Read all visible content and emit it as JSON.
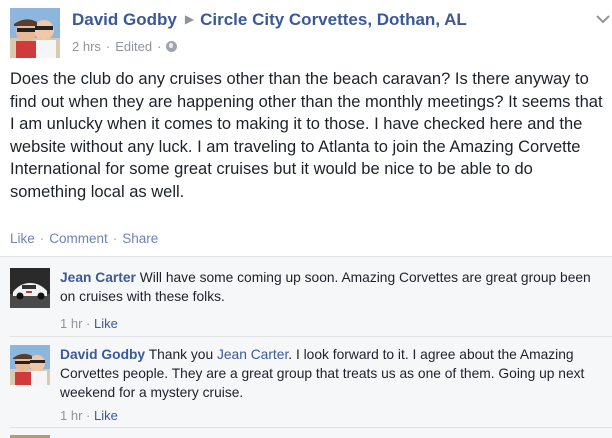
{
  "post": {
    "author": "David Godby",
    "group": "Circle City Corvettes, Dothan, AL",
    "time": "2 hrs",
    "edited": "Edited",
    "text": "Does the club do any cruises other than the beach caravan? Is there anyway to find out when they are happening other than the monthly meetings? It seems that I am unlucky when it comes to making it to those. I have checked here and the website without any luck. I am traveling to Atlanta to join the Amazing Corvette International for some great cruises but it would be nice to be able to do something local as well."
  },
  "actions": {
    "like": "Like",
    "comment": "Comment",
    "share": "Share"
  },
  "comments": [
    {
      "name": "Jean Carter",
      "text": "Will have some coming up soon. Amazing Corvettes are great group been on cruises with these folks.",
      "time": "1 hr",
      "like": "Like"
    },
    {
      "name": "David Godby",
      "text_before": "Thank you ",
      "mention": "Jean Carter",
      "text_after": ". I look forward to it. I agree about the Amazing Corvettes people. They are a great group that treats us as one of them. Going up next weekend for a mystery cruise.",
      "time": "1 hr",
      "like": "Like"
    }
  ],
  "icons": {
    "audience": "globe-icon",
    "arrow": "triangle-right-icon",
    "menu": "chevron-down-icon"
  },
  "colors": {
    "link": "#3b5998",
    "meta": "#90949c",
    "comments_bg": "#f6f7f9"
  }
}
